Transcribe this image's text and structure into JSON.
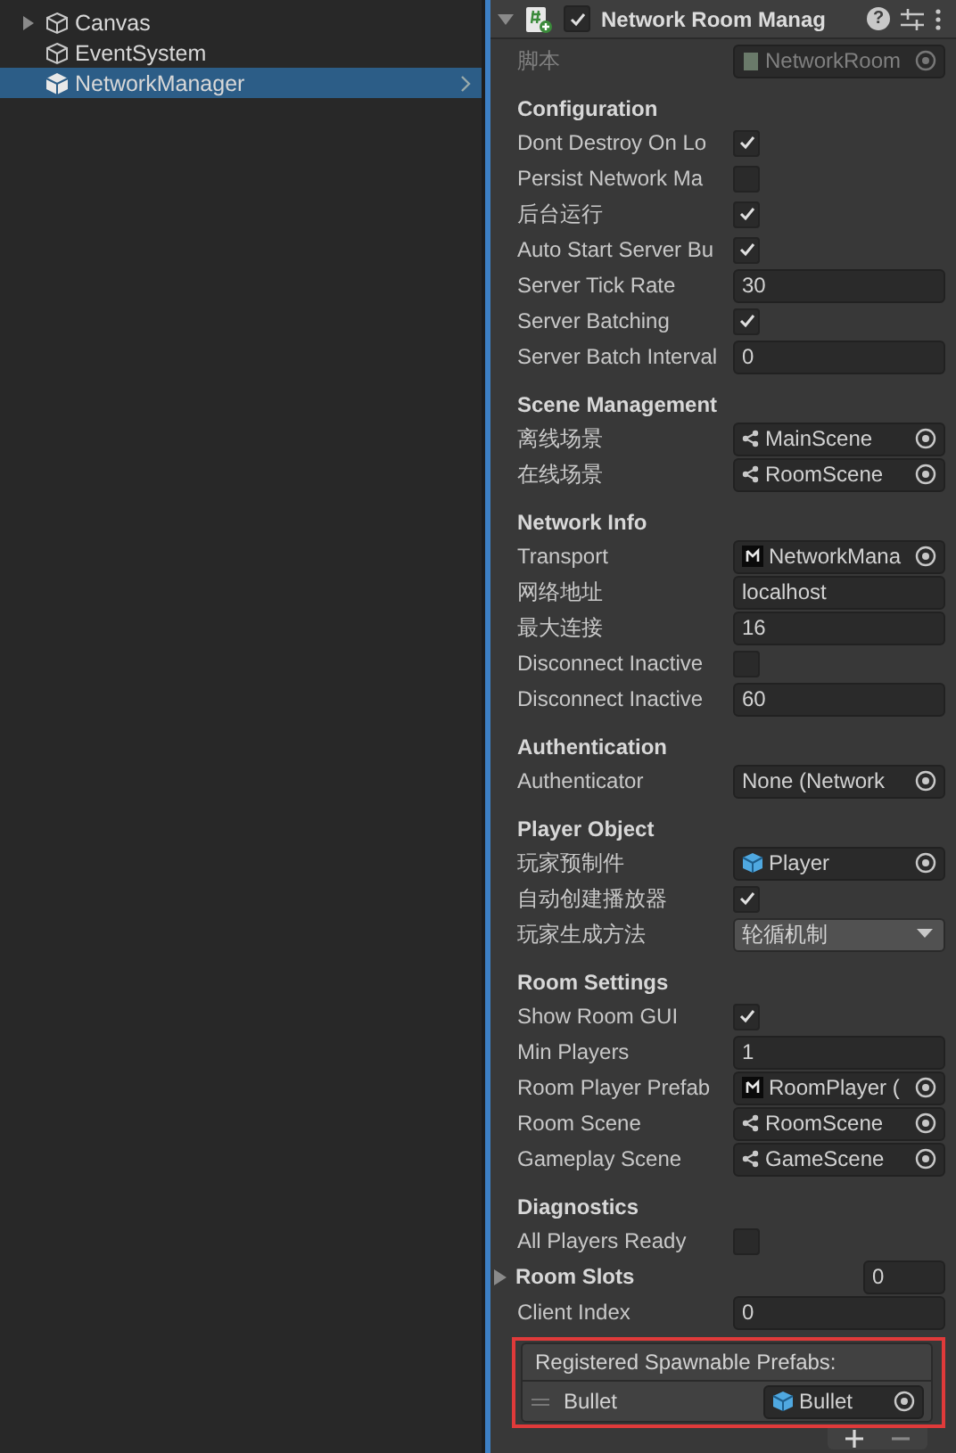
{
  "hierarchy": [
    {
      "label": "Canvas",
      "expandable": true,
      "selected": false
    },
    {
      "label": "EventSystem",
      "expandable": false,
      "selected": false
    },
    {
      "label": "NetworkManager",
      "expandable": false,
      "selected": true
    }
  ],
  "component": {
    "title": "Network Room Manag",
    "enabled": true,
    "help": "?",
    "script_label": "脚本",
    "script_value": "NetworkRoom"
  },
  "sections": [
    {
      "title": "Configuration",
      "rows": [
        {
          "kind": "checkbox",
          "label": "Dont Destroy On Lo",
          "checked": true
        },
        {
          "kind": "checkbox",
          "label": "Persist Network Ma",
          "checked": false
        },
        {
          "kind": "checkbox",
          "label": "后台运行",
          "checked": true
        },
        {
          "kind": "checkbox",
          "label": "Auto Start Server Bu",
          "checked": true
        },
        {
          "kind": "text",
          "label": "Server Tick Rate",
          "value": "30"
        },
        {
          "kind": "checkbox",
          "label": "Server Batching",
          "checked": true
        },
        {
          "kind": "text",
          "label": "Server Batch Interval",
          "value": "0"
        }
      ]
    },
    {
      "title": "Scene Management",
      "rows": [
        {
          "kind": "scene",
          "label": "离线场景",
          "value": "MainScene"
        },
        {
          "kind": "scene",
          "label": "在线场景",
          "value": "RoomScene"
        }
      ]
    },
    {
      "title": "Network Info",
      "rows": [
        {
          "kind": "network",
          "label": "Transport",
          "value": "NetworkMana"
        },
        {
          "kind": "text",
          "label": "网络地址",
          "value": "localhost"
        },
        {
          "kind": "text",
          "label": "最大连接",
          "value": "16"
        },
        {
          "kind": "checkbox",
          "label": "Disconnect Inactive",
          "checked": false
        },
        {
          "kind": "text",
          "label": "Disconnect Inactive",
          "value": "60"
        }
      ]
    },
    {
      "title": "Authentication",
      "rows": [
        {
          "kind": "object",
          "label": "Authenticator",
          "value": "None (Network"
        }
      ]
    },
    {
      "title": "Player Object",
      "rows": [
        {
          "kind": "prefab",
          "label": "玩家预制件",
          "value": "Player"
        },
        {
          "kind": "checkbox",
          "label": "自动创建播放器",
          "checked": true
        },
        {
          "kind": "dropdown",
          "label": "玩家生成方法",
          "value": "轮循机制"
        }
      ]
    },
    {
      "title": "Room Settings",
      "rows": [
        {
          "kind": "checkbox",
          "label": "Show Room GUI",
          "checked": true
        },
        {
          "kind": "text",
          "label": "Min Players",
          "value": "1"
        },
        {
          "kind": "network",
          "label": "Room Player Prefab",
          "value": "RoomPlayer ("
        },
        {
          "kind": "scene",
          "label": "Room Scene",
          "value": "RoomScene"
        },
        {
          "kind": "scene",
          "label": "Gameplay Scene",
          "value": "GameScene"
        }
      ]
    },
    {
      "title": "Diagnostics",
      "rows": [
        {
          "kind": "checkbox",
          "label": "All Players Ready",
          "checked": false
        },
        {
          "kind": "foldout",
          "label": "Room Slots",
          "value": "0"
        },
        {
          "kind": "text",
          "label": "Client Index",
          "value": "0"
        }
      ]
    }
  ],
  "spawnable": {
    "title": "Registered Spawnable Prefabs:",
    "items": [
      {
        "label": "Bullet",
        "value": "Bullet"
      }
    ]
  }
}
